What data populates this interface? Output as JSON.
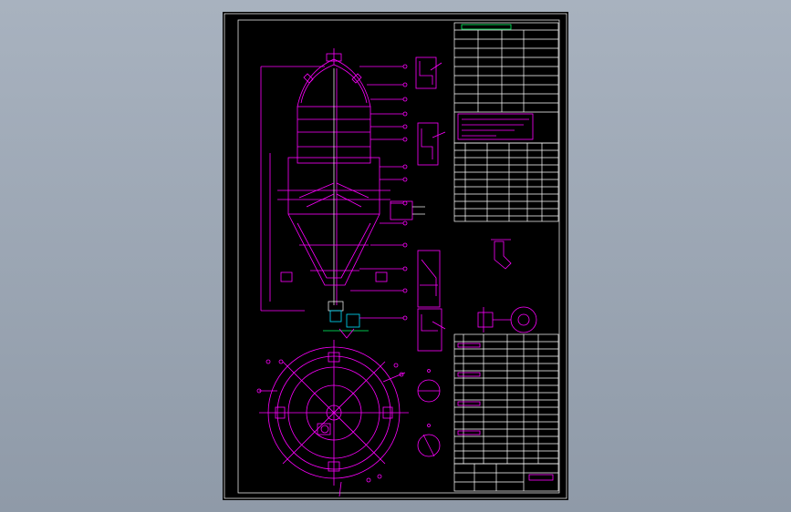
{
  "viewer": {
    "background_color": "#98a3b1"
  },
  "sheet": {
    "paper_color": "#000000",
    "colors": {
      "outline": "#ffffff",
      "geometry": "#ff00ff",
      "motor": "#00e0ff",
      "accent": "#00ff66"
    },
    "icons": [
      "reactor-vessel-elevation",
      "reactor-plan-view",
      "detail-view-a",
      "detail-view-b",
      "detail-view-c",
      "detail-view-d",
      "nozzle-detail",
      "flange-detail",
      "title-block",
      "parts-list",
      "nozzle-table",
      "technical-requirements"
    ]
  }
}
